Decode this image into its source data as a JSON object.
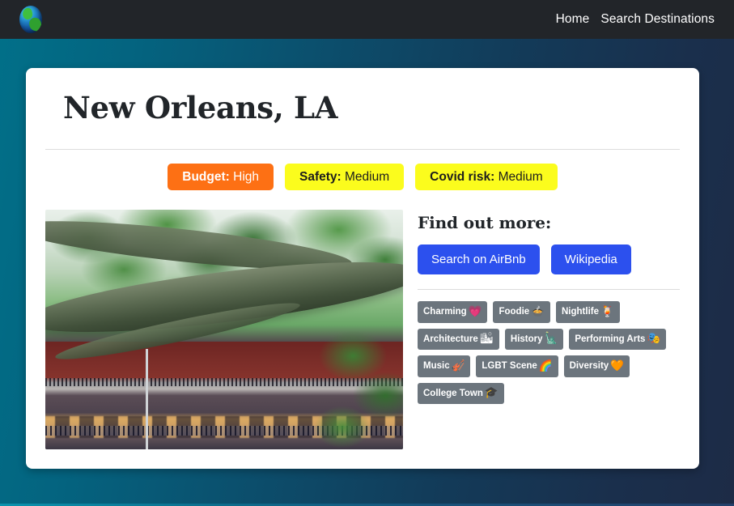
{
  "navbar": {
    "logo_icon": "globe-icon",
    "links": [
      {
        "label": "Home"
      },
      {
        "label": "Search Destinations"
      }
    ]
  },
  "card": {
    "title": "New Orleans, LA",
    "badges": [
      {
        "key": "Budget:",
        "value": "High",
        "bg": "#fd7014",
        "fg": "#ffffff"
      },
      {
        "key": "Safety:",
        "value": "Medium",
        "bg": "#fbfc1d",
        "fg": "#1d1d1d"
      },
      {
        "key": "Covid risk:",
        "value": "Medium",
        "bg": "#fbfc1d",
        "fg": "#1d1d1d"
      }
    ],
    "photo": {
      "alt": "Live oak branches over a French Quarter building with wrought-iron balconies"
    },
    "find_out_more": {
      "heading": "Find out more:",
      "buttons": [
        {
          "label": "Search on AirBnb"
        },
        {
          "label": "Wikipedia"
        }
      ]
    },
    "tags": [
      {
        "label": "Charming",
        "emoji": "💗"
      },
      {
        "label": "Foodie",
        "emoji": "🍲"
      },
      {
        "label": "Nightlife",
        "emoji": "🍹"
      },
      {
        "label": "Architecture",
        "emoji": "🏙"
      },
      {
        "label": "History",
        "emoji": "🗽"
      },
      {
        "label": "Performing Arts",
        "emoji": "🎭"
      },
      {
        "label": "Music",
        "emoji": "🎻"
      },
      {
        "label": "LGBT Scene",
        "emoji": "🌈"
      },
      {
        "label": "Diversity",
        "emoji": "🧡"
      },
      {
        "label": "College Town",
        "emoji": "🎓"
      }
    ]
  },
  "theme": {
    "navbar_bg": "#222529",
    "page_gradient_from": "#017089",
    "page_gradient_to": "#1d2b46",
    "card_bg": "#ffffff",
    "button_blue": "#2c50ee",
    "tag_gray": "#6c757d"
  }
}
